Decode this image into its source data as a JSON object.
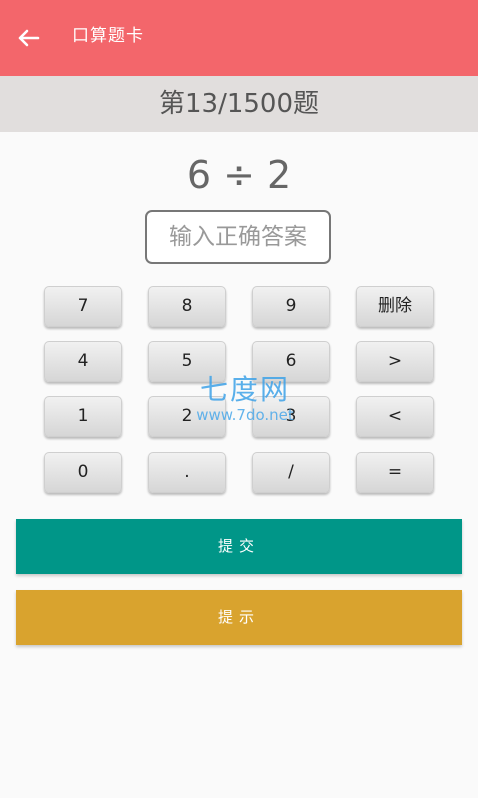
{
  "app_bar": {
    "title": "口算题卡",
    "background": "#f3666b",
    "back_icon": "arrow-left-icon"
  },
  "progress": {
    "text": "第13/1500题"
  },
  "question": {
    "text": "6 ÷ 2"
  },
  "answer": {
    "placeholder": "输入正确答案",
    "value": ""
  },
  "keypad": {
    "keys": [
      "7",
      "8",
      "9",
      "删除",
      "4",
      "5",
      "6",
      ">",
      "1",
      "2",
      "3",
      "<",
      "0",
      ".",
      "/",
      "="
    ]
  },
  "actions": {
    "submit_label": "提交",
    "submit_color": "#009688",
    "hint_label": "提示",
    "hint_color": "#d9a32e"
  },
  "watermark": {
    "title": "七度网",
    "url": "www.7do.net"
  }
}
